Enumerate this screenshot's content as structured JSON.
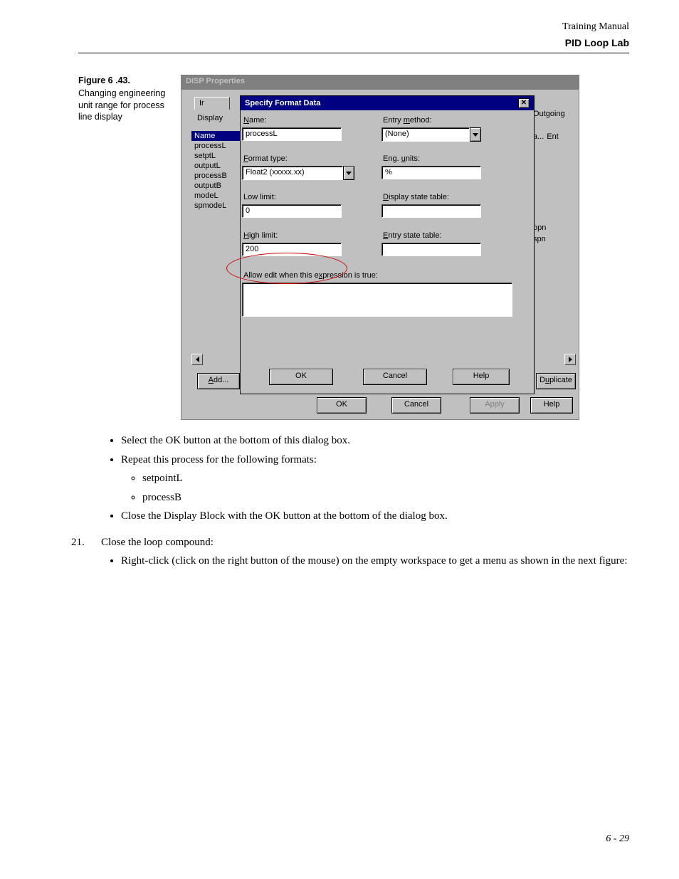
{
  "header": {
    "manual": "Training Manual",
    "lab": "PID Loop Lab"
  },
  "figure": {
    "number": "Figure 6 .43.",
    "caption": "Changing engineering unit range for process line display"
  },
  "backWindow": {
    "title": "DISP Properties",
    "tab": "Ir",
    "listLabel": "Display",
    "nameHeader": "Name",
    "listItems": [
      "processL",
      "setptL",
      "outputL",
      "processB",
      "outputB",
      "modeL",
      "spmodeL"
    ],
    "outgoingHeader": "Outgoing",
    "aHeader": "a...",
    "entHeader": "Ent",
    "rightValues": [
      ".",
      ".",
      ".",
      ".",
      "opn",
      "spn"
    ],
    "addBtn": "Add...",
    "duplicateBtn": "Duplicate",
    "okBtn": "OK",
    "cancelBtn": "Cancel",
    "applyBtn": "Apply",
    "helpBtn": "Help"
  },
  "dialog": {
    "title": "Specify Format Data",
    "nameLabel": "Name:",
    "nameValue": "processL",
    "formatTypeLabel": "Format type:",
    "formatTypeValue": "Float2 (xxxxx.xx)",
    "lowLimitLabel": "Low limit:",
    "lowLimitValue": "0",
    "highLimitLabel": "High limit:",
    "highLimitValue": "200",
    "allowEditLabel": "Allow edit when this expression is true:",
    "entryMethodLabel": "Entry method:",
    "entryMethodValue": "(None)",
    "engUnitsLabel": "Eng. units:",
    "engUnitsValue": "%",
    "displayStateLabel": "Display state table:",
    "entryStateLabel": "Entry state table:",
    "okBtn": "OK",
    "cancelBtn": "Cancel",
    "helpBtn": "Help"
  },
  "instructions": {
    "bullets1": [
      "Select the OK button at the bottom of this dialog box.",
      "Repeat this process for the following formats:"
    ],
    "subbullets": [
      "setpointL",
      "processB"
    ],
    "bullets2": [
      "Close the Display Block with the OK button at the bottom of the dialog box."
    ],
    "step21num": "21.",
    "step21text": "Close the loop compound:",
    "step21bullet": "Right-click (click on the right button of the mouse) on the empty workspace to get a menu as shown in the next figure:"
  },
  "footer": "6 - 29"
}
